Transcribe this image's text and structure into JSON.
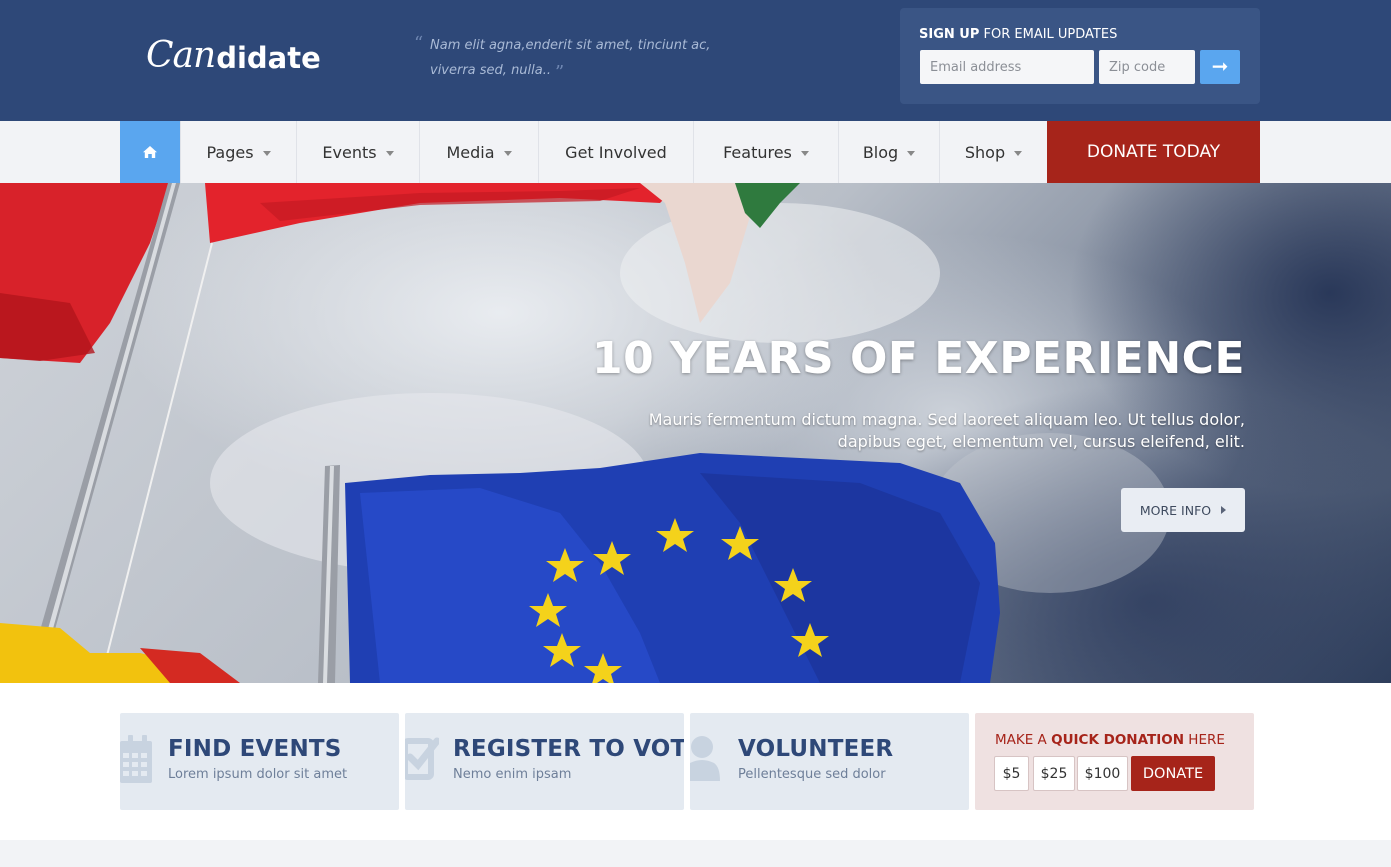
{
  "header": {
    "logo_script": "Can",
    "logo_bold": "didate",
    "quote": "Nam elit agna,enderit sit amet, tinciunt ac, viverra sed, nulla..",
    "signup": {
      "title_bold": "SIGN UP",
      "title_rest": " FOR EMAIL UPDATES",
      "email_placeholder": "Email address",
      "zip_placeholder": "Zip code",
      "submit_icon": "arrow-right-icon",
      "submit_glyph": "➞"
    }
  },
  "nav": {
    "home_icon": "home-icon",
    "items": [
      {
        "label": "Pages"
      },
      {
        "label": "Events"
      },
      {
        "label": "Media"
      },
      {
        "label": "Get Involved"
      },
      {
        "label": "Features"
      },
      {
        "label": "Blog"
      },
      {
        "label": "Shop"
      }
    ],
    "donate": "DONATE TODAY"
  },
  "hero": {
    "title": "10 YEARS OF EXPERIENCE",
    "text": "Mauris fermentum dictum magna. Sed laoreet aliquam leo. Ut tellus dolor, dapibus eget, elementum vel, cursus eleifend, elit.",
    "button": "MORE INFO"
  },
  "actions": [
    {
      "title": "FIND EVENTS",
      "subtitle": "Lorem ipsum dolor sit amet",
      "icon": "calendar-icon"
    },
    {
      "title": "REGISTER TO VOTE",
      "subtitle": "Nemo enim ipsam",
      "icon": "checkbox-icon"
    },
    {
      "title": "VOLUNTEER",
      "subtitle": "Pellentesque sed dolor",
      "icon": "user-icon"
    }
  ],
  "donation": {
    "prefix": "MAKE A ",
    "bold": "QUICK DONATION",
    "suffix": " HERE",
    "amounts": [
      "$5",
      "$25",
      "$100"
    ],
    "button": "DONATE"
  },
  "colors": {
    "header_bg": "#2e4878",
    "accent_blue": "#5aa6ef",
    "donate_red": "#a6241a",
    "nav_bg": "#f2f3f6",
    "action_bg": "#e4eaf1",
    "donation_bg": "#efe1e1"
  }
}
